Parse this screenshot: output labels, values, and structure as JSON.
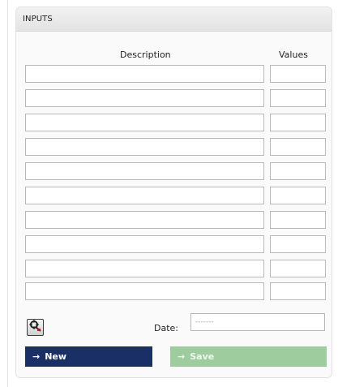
{
  "panel": {
    "title": "INPUTS"
  },
  "table": {
    "description_header": "Description",
    "values_header": "Values",
    "rows": [
      {
        "description": "",
        "value": ""
      },
      {
        "description": "",
        "value": ""
      },
      {
        "description": "",
        "value": ""
      },
      {
        "description": "",
        "value": ""
      },
      {
        "description": "",
        "value": ""
      },
      {
        "description": "",
        "value": ""
      },
      {
        "description": "",
        "value": ""
      },
      {
        "description": "",
        "value": ""
      },
      {
        "description": "",
        "value": ""
      },
      {
        "description": "",
        "value": ""
      }
    ]
  },
  "tools": {
    "icon": "tool-settings-icon"
  },
  "date": {
    "label": "Date:",
    "placeholder": "-------"
  },
  "actions": {
    "new_label": "New",
    "save_label": "Save",
    "arrow_icon": "→",
    "new_color": "#1a2f66",
    "save_color": "#9fcc9f"
  }
}
